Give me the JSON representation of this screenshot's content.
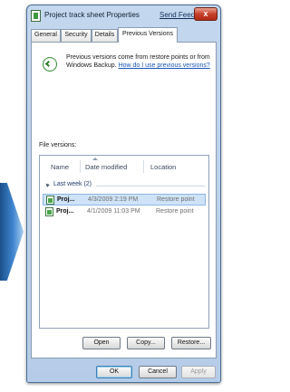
{
  "window": {
    "title": "Project track sheet Properties",
    "send_feedback": "Send Feedback",
    "close_label": "x"
  },
  "tabs": [
    {
      "label": "General"
    },
    {
      "label": "Security"
    },
    {
      "label": "Details"
    },
    {
      "label": "Previous Versions",
      "active": true
    }
  ],
  "info": {
    "text": "Previous versions come from restore points or from Windows Backup. ",
    "link": "How do I use previous versions?"
  },
  "file_versions_label": "File versions:",
  "columns": [
    "Name",
    "Date modified",
    "Location"
  ],
  "groups": [
    {
      "label": "Last week (2)",
      "rows": [
        {
          "name": "Proj...",
          "date": "4/3/2009 2:19 PM",
          "location": "Restore point",
          "selected": true
        },
        {
          "name": "Proj...",
          "date": "4/1/2009 11:03 PM",
          "location": "Restore point",
          "selected": false
        }
      ]
    }
  ],
  "actions": {
    "open": "Open",
    "copy": "Copy...",
    "restore": "Restore..."
  },
  "dialog_buttons": {
    "ok": "OK",
    "cancel": "Cancel",
    "apply": "Apply"
  }
}
